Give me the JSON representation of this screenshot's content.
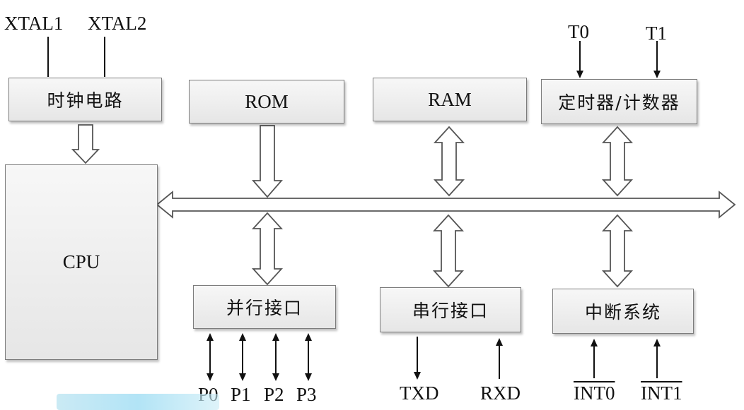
{
  "blocks": {
    "clock": "时钟电路",
    "cpu": "CPU",
    "rom": "ROM",
    "ram": "RAM",
    "timer": "定时器/计数器",
    "parallel": "并行接口",
    "serial": "串行接口",
    "interrupt": "中断系统"
  },
  "signals": {
    "xtal1": "XTAL1",
    "xtal2": "XTAL2",
    "t0": "T0",
    "t1": "T1",
    "p0": "P0",
    "p1": "P1",
    "p2": "P2",
    "p3": "P3",
    "txd": "TXD",
    "rxd": "RXD",
    "int0": "INT0",
    "int1": "INT1"
  }
}
